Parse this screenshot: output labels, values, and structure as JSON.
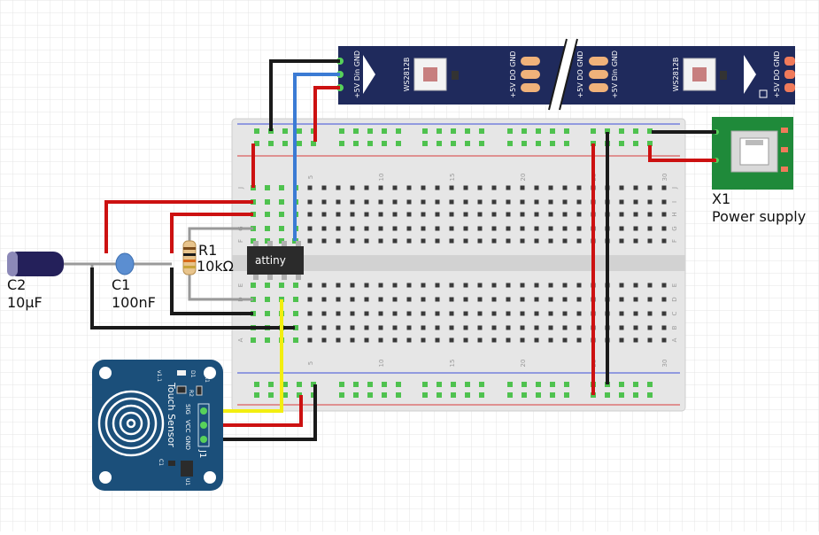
{
  "breadboard": {
    "column_numbers": [
      "5",
      "10",
      "15",
      "20",
      "25",
      "30"
    ],
    "row_letters_top": [
      "J",
      "I",
      "H",
      "G",
      "F"
    ],
    "row_letters_bottom": [
      "E",
      "D",
      "C",
      "B",
      "A"
    ]
  },
  "ic": {
    "label": "attiny"
  },
  "resistor": {
    "ref": "R1",
    "value": "10kΩ"
  },
  "cap_ceramic": {
    "ref": "C1",
    "value": "100nF"
  },
  "cap_electrolytic": {
    "ref": "C2",
    "value": "10µF"
  },
  "power_supply": {
    "ref": "X1",
    "name": "Power supply"
  },
  "led_strip": {
    "pin_labels": [
      "GND",
      "Din",
      "+5V"
    ],
    "pin_labels_right": [
      "GND",
      "DO",
      "+5V"
    ],
    "chip_label": "WS2812B"
  },
  "touch_sensor": {
    "title": "Touch Sensor",
    "version": "v1.1",
    "pins": [
      "SIG",
      "VCC",
      "GND"
    ],
    "header": "J1",
    "parts": [
      "C1",
      "U1",
      "R1",
      "R2",
      "D1"
    ]
  },
  "colors": {
    "wire_red": "#cc1111",
    "wire_black": "#1a1a1a",
    "wire_blue": "#3b7bd4",
    "wire_yellow": "#f2ee10",
    "strip": "#1f2a5c",
    "pcb_green": "#1f8a3a",
    "sensor_blue": "#1b4f7a",
    "breadboard": "#e6e6e6"
  }
}
